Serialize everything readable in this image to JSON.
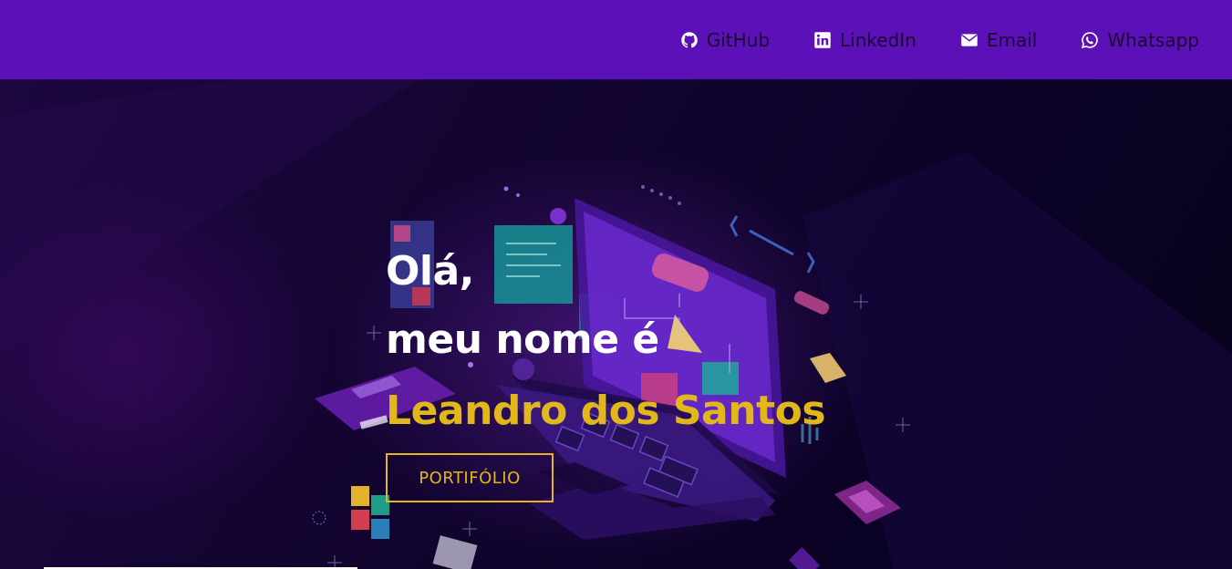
{
  "nav": {
    "links": [
      {
        "label": "GitHub",
        "icon": "github-icon"
      },
      {
        "label": "LinkedIn",
        "icon": "linkedin-icon"
      },
      {
        "label": "Email",
        "icon": "envelope-icon"
      },
      {
        "label": "Whatsapp",
        "icon": "whatsapp-icon"
      }
    ]
  },
  "hero": {
    "line1": "Olá,",
    "line2": "meu nome é",
    "name": "Leandro dos Santos",
    "button_label": "PORTIFÓLIO"
  },
  "colors": {
    "nav_background": "#5c10b8",
    "nav_text": "#1a0a30",
    "accent": "#e1b71c",
    "hero_background": "#0d0428",
    "heading": "#ffffff"
  }
}
